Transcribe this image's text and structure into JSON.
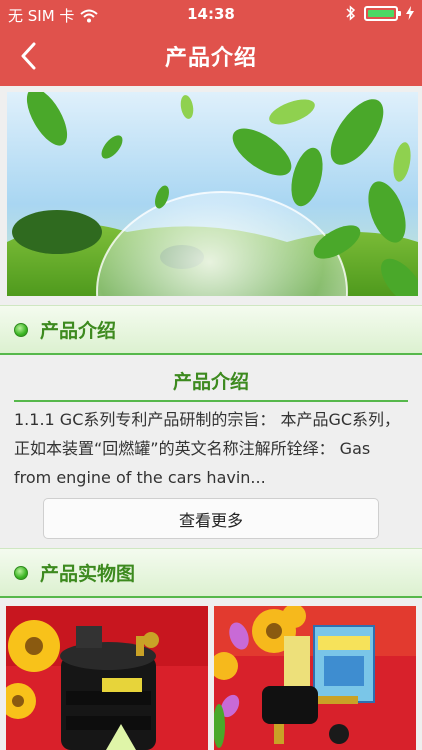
{
  "status_bar": {
    "carrier": "无 SIM 卡",
    "time": "14:38"
  },
  "nav": {
    "title": "产品介绍",
    "back_icon": "chevron-left-icon"
  },
  "sections": {
    "intro_header": "产品介绍",
    "photos_header": "产品实物图"
  },
  "intro": {
    "title": "产品介绍",
    "body": "1.1.1 GC系列专利产品研制的宗旨： 本产品GC系列，正如本装置“回燃罐”的英文名称注解所铨绎： Gas from engine of the cars havin...",
    "more_label": "查看更多"
  },
  "colors": {
    "header_red": "#e0524c",
    "accent_green": "#3d8a1f",
    "divider_green": "#56b84b"
  }
}
